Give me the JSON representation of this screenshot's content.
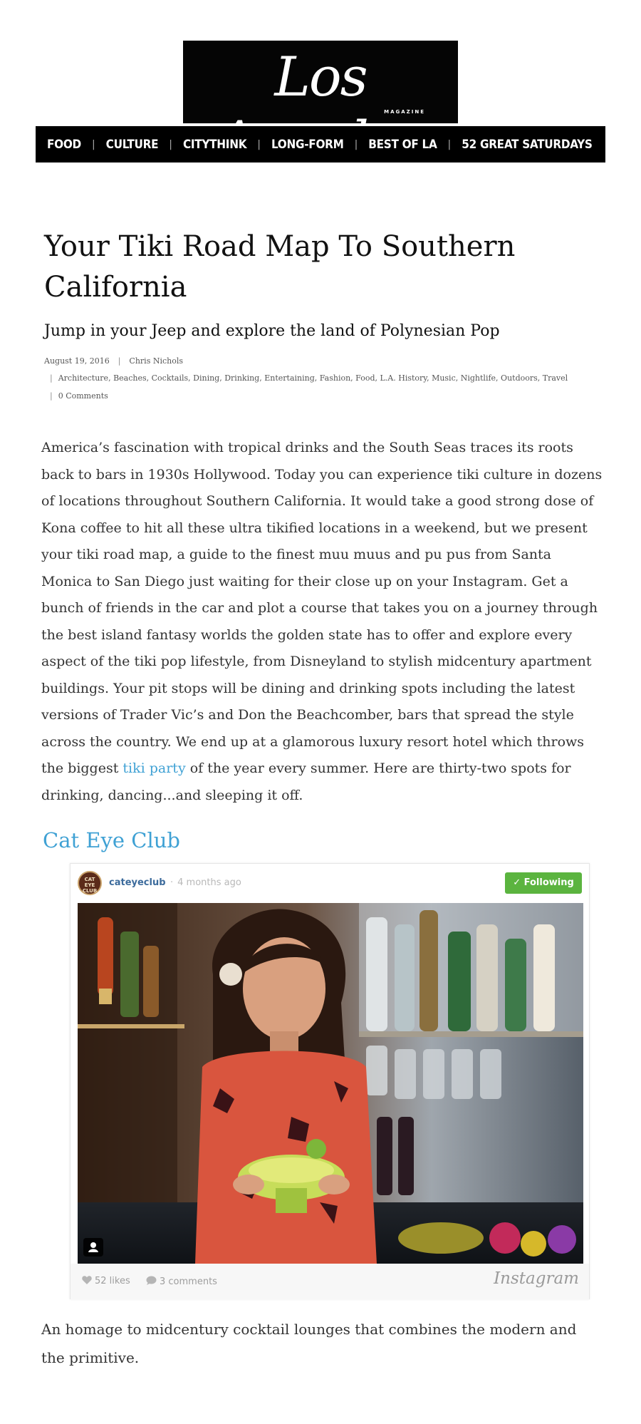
{
  "masthead": {
    "logo_text": "Los Angeles",
    "logo_subtext": "MAGAZINE",
    "nav": [
      "FOOD",
      "CULTURE",
      "CITYTHINK",
      "LONG-FORM",
      "BEST OF LA",
      "52 GREAT SATURDAYS"
    ]
  },
  "article": {
    "title": "Your Tiki Road Map To Southern California",
    "subtitle": "Jump in your Jeep and explore the land of Polynesian Pop",
    "date": "August 19, 2016",
    "author": "Chris Nichols",
    "tags": [
      "Architecture",
      "Beaches",
      "Cocktails",
      "Dining",
      "Drinking",
      "Entertaining",
      "Fashion",
      "Food",
      "L.A. History",
      "Music",
      "Nightlife",
      "Outdoors",
      "Travel"
    ],
    "comments": "0 Comments",
    "body_before_link": "America’s fascination with tropical drinks and the South Seas traces its roots back to bars in 1930s Hollywood. Today you can experience tiki culture in dozens of locations throughout Southern California. It would take a good strong dose of Kona coffee to hit all these ultra tikified locations in a weekend, but we present your tiki road map, a guide to the finest muu muus and pu pus from Santa Monica to San Diego just waiting for their close up on your Instagram. Get a bunch of friends in the car and plot a course that takes you on a journey through the best island fantasy worlds the golden state has to offer and explore every aspect of the tiki pop lifestyle, from Disneyland to stylish midcentury apartment buildings. Your pit stops will be dining and drinking spots including the latest versions of Trader Vic’s and Don the Beachcomber, bars that spread the style across the country. We end up at a glamorous luxury resort hotel which throws the biggest ",
    "body_link": "tiki party",
    "body_after_link": " of the year every summer. Here are thirty-two spots for drinking, dancing...and sleeping it off.",
    "section_title": "Cat Eye Club",
    "caption": "An homage to midcentury cocktail lounges that combines the modern and the primitive."
  },
  "instagram": {
    "avatar_text": "CAT EYE CLUB",
    "username": "cateyeclub",
    "time_ago": "4 months ago",
    "follow_label": "✓ Following",
    "likes": "52 likes",
    "comments": "3 comments",
    "wordmark": "Instagram"
  },
  "colors": {
    "link": "#3fa1d4",
    "follow_green": "#5bb43f",
    "nav_background": "#000000"
  }
}
